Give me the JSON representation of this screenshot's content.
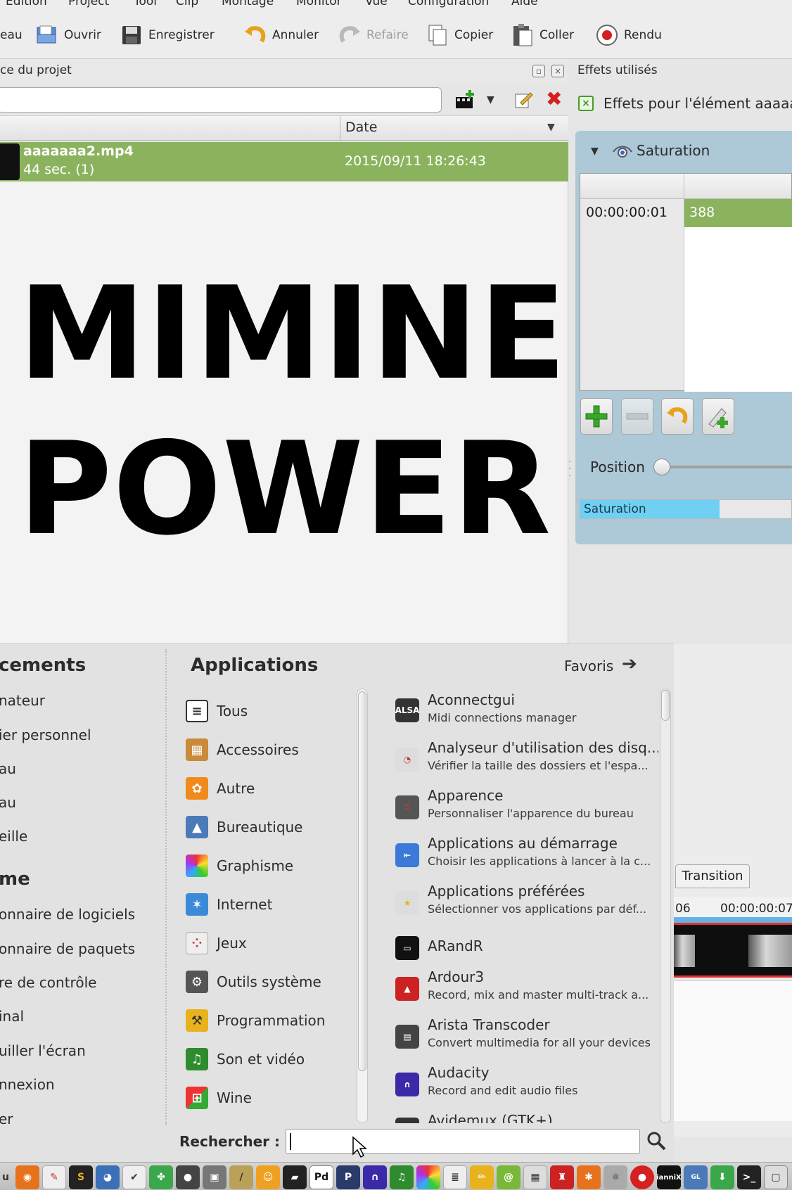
{
  "menubar": {
    "items": [
      "Édition",
      "Project",
      "Tool",
      "Clip",
      "Montage",
      "Monitor",
      "Vue",
      "Configuration",
      "Aide"
    ]
  },
  "toolbar": {
    "buttons": [
      {
        "label": "eau",
        "icon": "new-icon"
      },
      {
        "label": "Ouvrir",
        "icon": "open-icon"
      },
      {
        "label": "Enregistrer",
        "icon": "save-icon"
      },
      {
        "label": "Annuler",
        "icon": "undo-icon"
      },
      {
        "label": "Refaire",
        "icon": "redo-icon",
        "disabled": true
      },
      {
        "label": "Copier",
        "icon": "copy-icon"
      },
      {
        "label": "Coller",
        "icon": "paste-icon"
      },
      {
        "label": "Rendu",
        "icon": "record-icon"
      }
    ]
  },
  "project_bin": {
    "title": "ce du projet",
    "column_date": "Date",
    "clip": {
      "name": "aaaaaaa2.mp4",
      "duration": "44 sec. (1)",
      "date": "2015/09/11 18:26:43"
    },
    "preview_text": [
      "MIMINE",
      "POWER"
    ]
  },
  "effects": {
    "panel_title": "Effets utilisés",
    "for_element": "Effets pour l'élément aaaaa",
    "effect_name": "Saturation",
    "keyframe_time": "00:00:00:01",
    "keyframe_value": "388",
    "position_label": "Position",
    "param_label": "Saturation",
    "param_fill_fraction": 0.66
  },
  "timeline": {
    "transition_label": "Transition",
    "ruler": [
      "06",
      "00:00:00:07"
    ]
  },
  "app_menu": {
    "places_header": "cements",
    "places": [
      "nateur",
      "ier personnel",
      "au",
      "au",
      "eille"
    ],
    "system_header": "me",
    "system": [
      "onnaire de logiciels",
      "onnaire de paquets",
      "re de contrôle",
      "inal",
      "uiller l'écran",
      "nnexion",
      "er"
    ],
    "applications_header": "Applications",
    "favorites_label": "Favoris",
    "categories": [
      "Tous",
      "Accessoires",
      "Autre",
      "Bureautique",
      "Graphisme",
      "Internet",
      "Jeux",
      "Outils système",
      "Programmation",
      "Son et vidéo",
      "Wine"
    ],
    "apps": [
      {
        "name": "Aconnectgui",
        "desc": "Midi connections manager"
      },
      {
        "name": "Analyseur d'utilisation des disq...",
        "desc": "Vérifier la taille des dossiers et l'espa..."
      },
      {
        "name": "Apparence",
        "desc": "Personnaliser l'apparence du bureau"
      },
      {
        "name": "Applications au démarrage",
        "desc": "Choisir les applications à lancer à la c..."
      },
      {
        "name": "Applications préférées",
        "desc": "Sélectionner vos applications par déf..."
      },
      {
        "name": "ARandR",
        "desc": ""
      },
      {
        "name": "Ardour3",
        "desc": "Record, mix and master multi-track a..."
      },
      {
        "name": "Arista Transcoder",
        "desc": "Convert multimedia for all your devices"
      },
      {
        "name": "Audacity",
        "desc": "Record and edit audio files"
      },
      {
        "name": "Avidemux (GTK+)",
        "desc": ""
      }
    ],
    "search_label": "Rechercher :",
    "search_value": ""
  },
  "colors": {
    "selection_green": "#8bb35e",
    "effect_blue": "#adc8d7",
    "slider_cyan": "#6fd0f3",
    "timeline_red": "#e03030"
  }
}
